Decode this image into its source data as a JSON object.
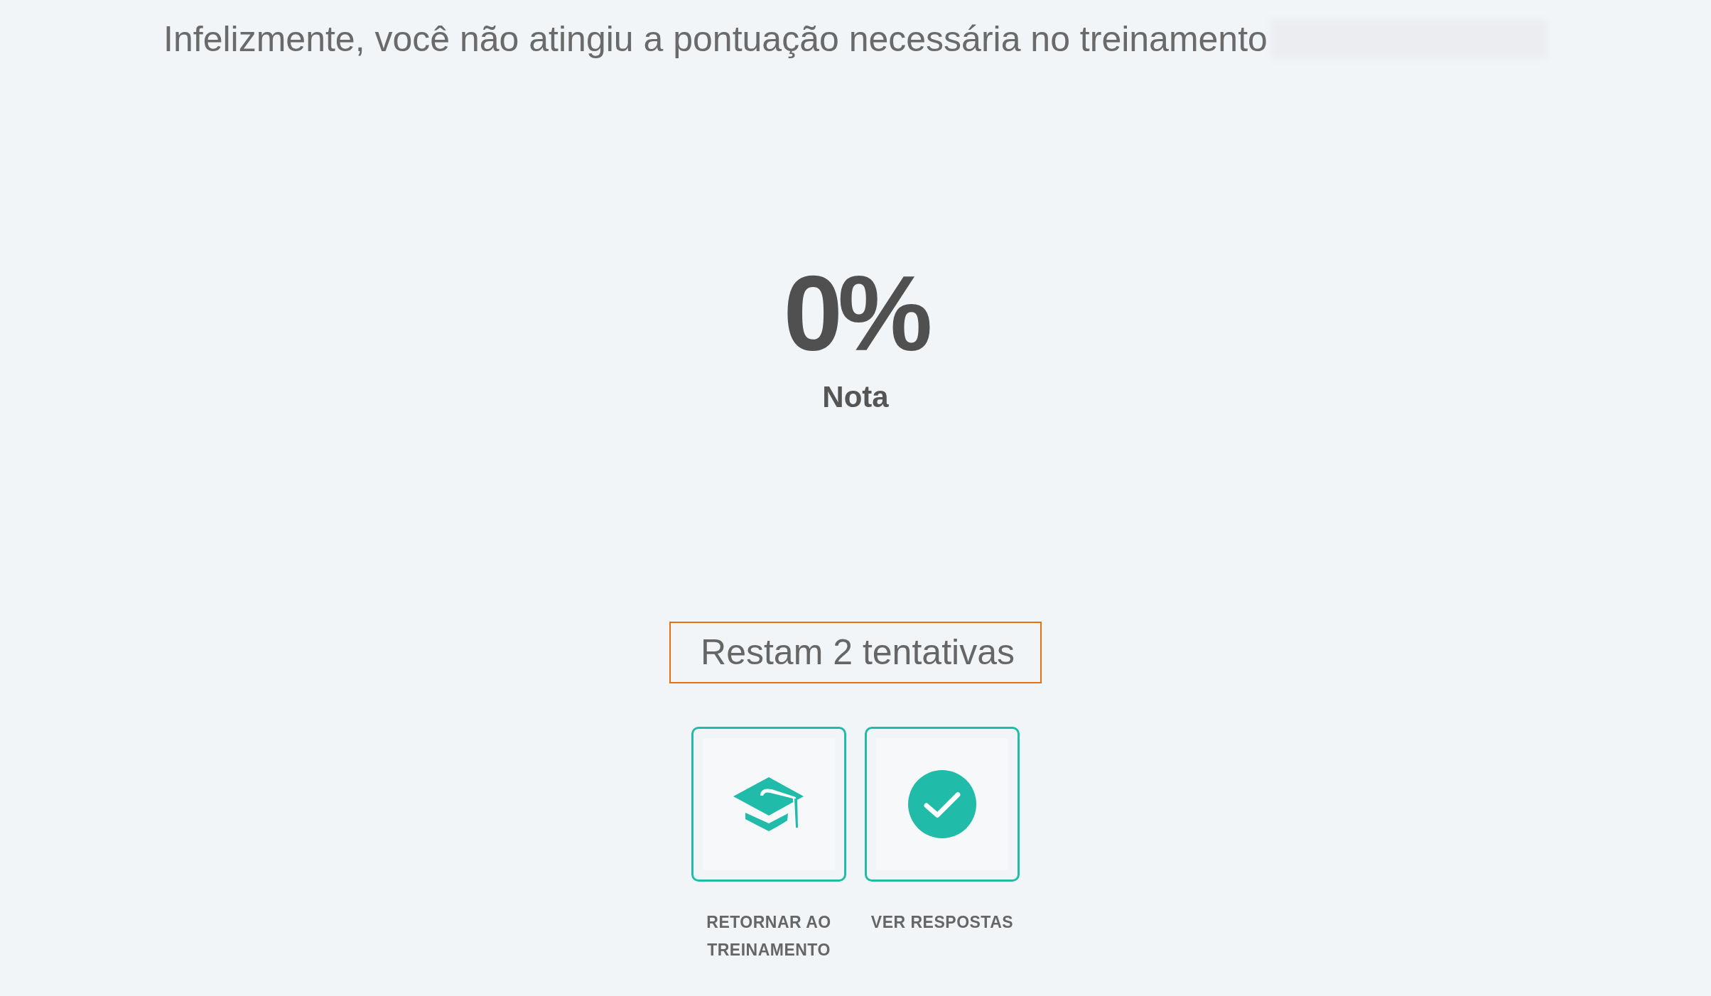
{
  "heading": {
    "text": "Infelizmente, você não atingiu a pontuação necessária no treinamento",
    "name_blurred": true
  },
  "score": {
    "value": "0%",
    "label": "Nota"
  },
  "attempts": {
    "text": "Restam 2 tentativas"
  },
  "actions": [
    {
      "label": "RETORNAR AO TREINAMENTO"
    },
    {
      "label": "VER RESPOSTAS"
    }
  ]
}
